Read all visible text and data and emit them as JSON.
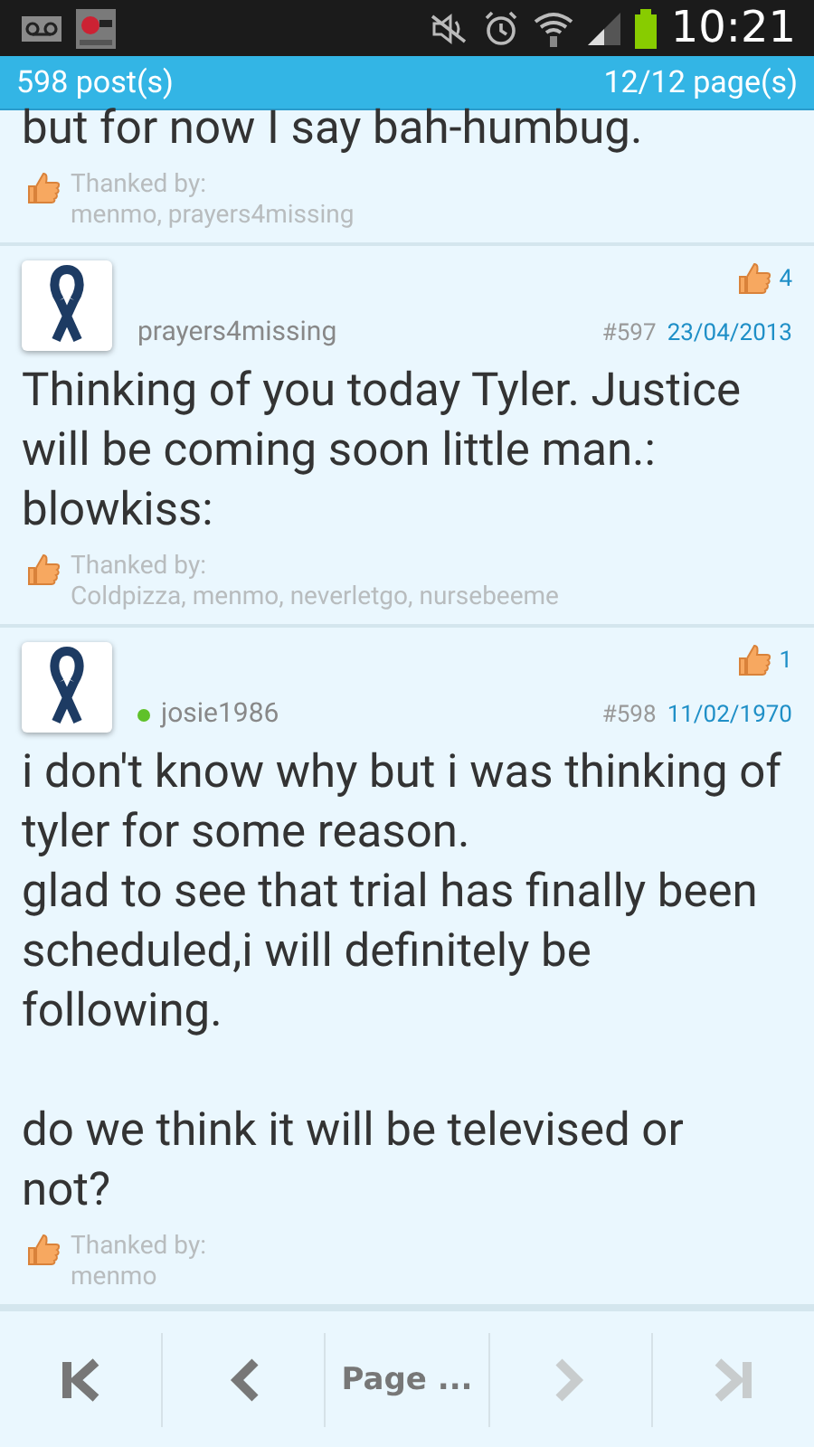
{
  "status_bar": {
    "time": "10:21"
  },
  "header": {
    "posts": "598 post(s)",
    "pages": "12/12 page(s)"
  },
  "posts": [
    {
      "body": "but for now I say bah-humbug.",
      "thanked_label": "Thanked by:",
      "thanked_by": "menmo, prayers4missing"
    },
    {
      "thanks_count": "4",
      "author": "prayers4missing",
      "online": false,
      "number": "#597",
      "date": "23/04/2013",
      "body": "Thinking of you today Tyler. Justice will be coming soon little man.: blowkiss:",
      "thanked_label": "Thanked by:",
      "thanked_by": "Coldpizza, menmo, neverletgo, nursebeeme"
    },
    {
      "thanks_count": "1",
      "author": "josie1986",
      "online": true,
      "number": "#598",
      "date": "11/02/1970",
      "body": "i don't know why but i was thinking of tyler for some reason.\nglad to see that trial has finally been scheduled,i will definitely be following.\n\ndo we think it will be televised or not?",
      "thanked_label": "Thanked by:",
      "thanked_by": "menmo"
    }
  ],
  "nav": [
    {
      "kind": "first",
      "disabled": false
    },
    {
      "kind": "prev",
      "disabled": false
    },
    {
      "kind": "page",
      "label": "Page ...",
      "disabled": false
    },
    {
      "kind": "next",
      "disabled": true
    },
    {
      "kind": "last",
      "disabled": true
    }
  ]
}
